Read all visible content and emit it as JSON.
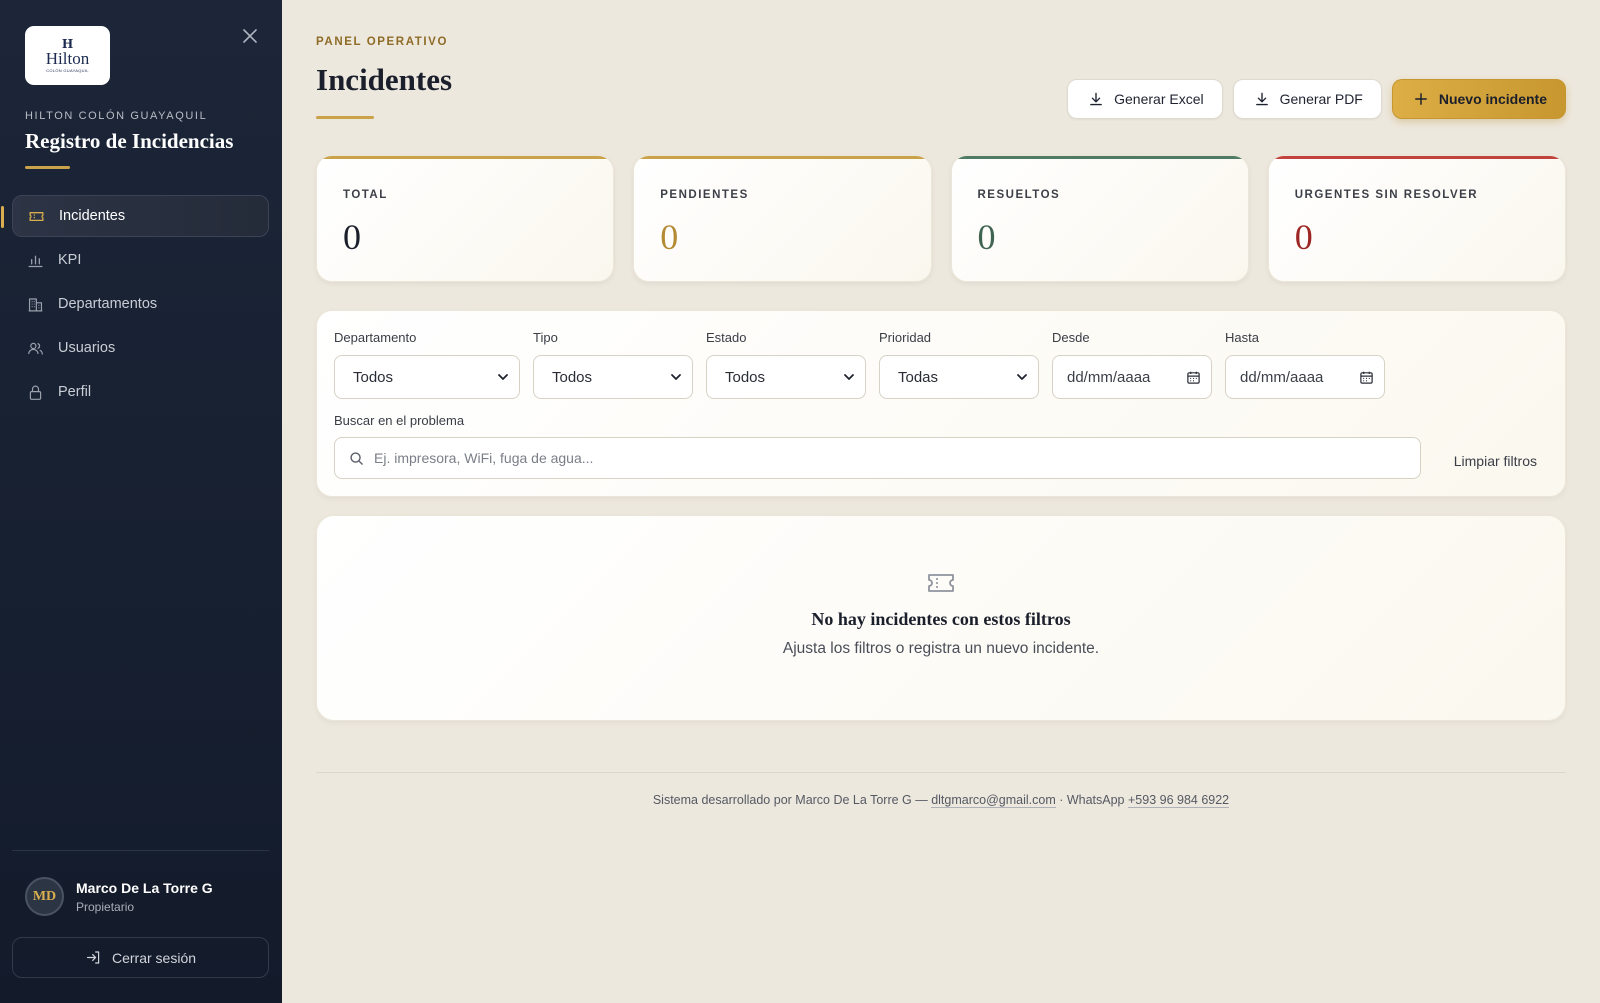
{
  "sidebar": {
    "logo": {
      "mark": "H",
      "word": "Hilton",
      "sub": "COLÓN GUAYAQUIL"
    },
    "hotel": "HILTON COLÓN GUAYAQUIL",
    "title": "Registro de Incidencias",
    "items": [
      {
        "label": "Incidentes",
        "icon": "ticket-icon",
        "active": true
      },
      {
        "label": "KPI",
        "icon": "bar-chart-icon",
        "active": false
      },
      {
        "label": "Departamentos",
        "icon": "building-icon",
        "active": false
      },
      {
        "label": "Usuarios",
        "icon": "users-icon",
        "active": false
      },
      {
        "label": "Perfil",
        "icon": "lock-icon",
        "active": false
      }
    ],
    "user": {
      "initials": "MD",
      "name": "Marco De La Torre G",
      "role": "Propietario"
    },
    "logout_label": "Cerrar sesión"
  },
  "header": {
    "eyebrow": "PANEL OPERATIVO",
    "title": "Incidentes",
    "actions": {
      "excel": "Generar Excel",
      "pdf": "Generar PDF",
      "new": "Nuevo incidente"
    }
  },
  "stats": [
    {
      "label": "TOTAL",
      "value": "0",
      "accent": "#c9a24a",
      "color": "#1b1f2b"
    },
    {
      "label": "PENDIENTES",
      "value": "0",
      "accent": "#c9a24a",
      "color": "#b58a35"
    },
    {
      "label": "RESUELTOS",
      "value": "0",
      "accent": "#4f7a63",
      "color": "#3f6452"
    },
    {
      "label": "URGENTES SIN RESOLVER",
      "value": "0",
      "accent": "#c2423e",
      "color": "#9e2622"
    }
  ],
  "filters": {
    "departamento": {
      "label": "Departamento",
      "value": "Todos"
    },
    "tipo": {
      "label": "Tipo",
      "value": "Todos"
    },
    "estado": {
      "label": "Estado",
      "value": "Todos"
    },
    "prioridad": {
      "label": "Prioridad",
      "value": "Todas"
    },
    "desde": {
      "label": "Desde",
      "placeholder": "dd/mm/aaaa"
    },
    "hasta": {
      "label": "Hasta",
      "placeholder": "dd/mm/aaaa"
    },
    "search": {
      "label": "Buscar en el problema",
      "placeholder": "Ej. impresora, WiFi, fuga de agua..."
    },
    "clear_label": "Limpiar filtros"
  },
  "empty": {
    "title": "No hay incidentes con estos filtros",
    "text": "Ajusta los filtros o registra un nuevo incidente."
  },
  "footer": {
    "prefix": "Sistema desarrollado por Marco De La Torre G — ",
    "email": "dltgmarco@gmail.com",
    "middle": " · WhatsApp ",
    "phone": "+593 96 984 6922"
  },
  "colors": {
    "gold": "#c9a24a",
    "sidebar_bg": "#1c2638",
    "page_bg": "#ede8de"
  }
}
